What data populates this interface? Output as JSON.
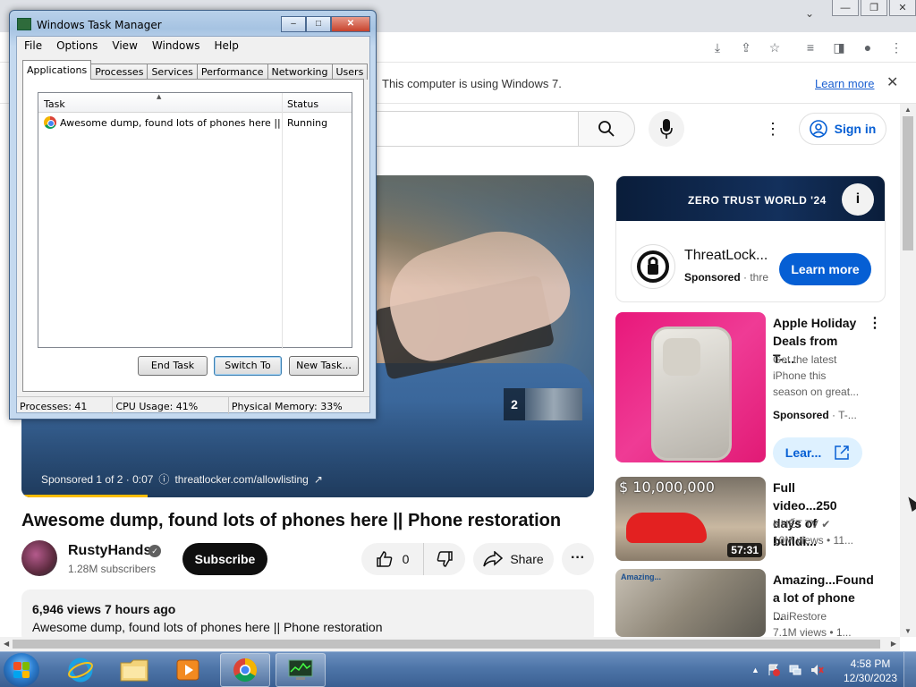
{
  "browser": {
    "window_buttons": [
      "—",
      "❐",
      "✕"
    ],
    "tab_dropdown": "⌄",
    "infobar": {
      "message": "This computer is using Windows 7.",
      "link": "Learn more",
      "close": "✕"
    }
  },
  "youtube": {
    "sign_in": "Sign in",
    "player": {
      "ad_count": "2",
      "sponsored": "Sponsored 1 of 2 · 0:07",
      "info_glyph": "ⓘ",
      "url": "threatlocker.com/allowlisting",
      "progress": 0.22
    },
    "video": {
      "title": "Awesome dump, found lots of phones here || Phone restoration",
      "channel": "RustyHands",
      "subscribers": "1.28M subscribers",
      "subscribe": "Subscribe",
      "likes": "0",
      "share": "Share",
      "more": "···",
      "views_time": "6,946 views  7 hours ago",
      "description": "Awesome dump, found lots of phones here || Phone restoration"
    },
    "ad_card": {
      "banner": "ZERO TRUST WORLD '24",
      "info": "i",
      "name": "ThreatLock...",
      "sponsored": "Sponsored",
      "sponsored_suffix": " · thre",
      "cta": "Learn more"
    },
    "recommendations": [
      {
        "title": "Apple Holiday Deals from T-...",
        "desc": "Get the latest iPhone this season on great...",
        "sponsored": "Sponsored",
        "sponsored_suffix": " · T-...",
        "cta": "Lear...",
        "menu": "⋮"
      },
      {
        "thumb_text": "$ 10,000,000",
        "title": "Full video...250 days of buildi...",
        "channel": "NHẾT TV ✔",
        "meta": "10M views  • 11...",
        "duration": "57:31"
      },
      {
        "thumb_text": "Amazing...",
        "title": "Amazing...Found a lot of phone ...",
        "channel": "DaiRestore",
        "meta": "7.1M views  • 1..."
      }
    ]
  },
  "taskmgr": {
    "title": "Windows Task Manager",
    "buttons": [
      "–",
      "□",
      "✕"
    ],
    "menus": [
      "File",
      "Options",
      "View",
      "Windows",
      "Help"
    ],
    "tabs": [
      "Applications",
      "Processes",
      "Services",
      "Performance",
      "Networking",
      "Users"
    ],
    "columns": {
      "task": "Task",
      "status": "Status"
    },
    "rows": [
      {
        "task": "Awesome dump, found lots of phones here || Ph...",
        "status": "Running"
      }
    ],
    "actions": {
      "end_task": "End Task",
      "switch_to": "Switch To",
      "new_task": "New Task..."
    },
    "status": {
      "processes": "Processes: 41",
      "cpu": "CPU Usage: 41%",
      "memory": "Physical Memory: 33%"
    }
  },
  "taskbar": {
    "tray_arrow": "▲",
    "time": "4:58 PM",
    "date": "12/30/2023"
  },
  "colors": {
    "yt_blue": "#065fd4",
    "taskbar": "#4e75a8",
    "tmobile_pink": "#e8177a"
  }
}
